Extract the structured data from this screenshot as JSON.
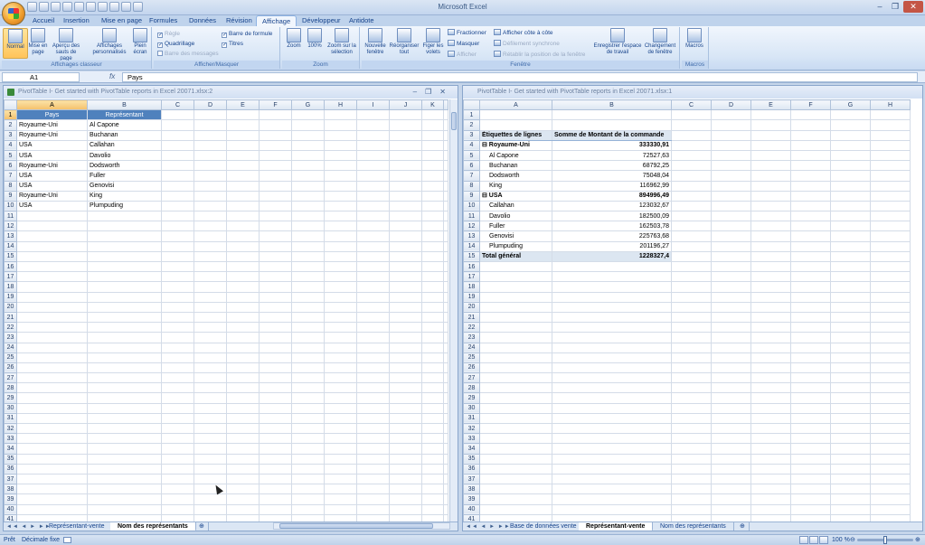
{
  "window": {
    "title": "Microsoft Excel"
  },
  "ribbon_tabs": [
    "Accueil",
    "Insertion",
    "Mise en page",
    "Formules",
    "Données",
    "Révision",
    "Affichage",
    "Développeur",
    "Antidote"
  ],
  "ribbon": {
    "groups": {
      "affichages": "Affichages classeur",
      "afficher": "Afficher/Masquer",
      "zoom": "Zoom",
      "fenetre": "Fenêtre",
      "macros": "Macros"
    },
    "buttons": {
      "normal": "Normal",
      "mise_en_page": "Mise en page",
      "apercu": "Aperçu des sauts de page",
      "affichages_perso": "Affichages personnalisés",
      "plein_ecran": "Plein écran",
      "zoom": "Zoom",
      "cent": "100%",
      "zoom_selection": "Zoom sur la sélection",
      "nouvelle_fenetre": "Nouvelle fenêtre",
      "reorganiser": "Réorganiser tout",
      "figer": "Figer les volets",
      "enregistrer": "Enregistrer l'espace de travail",
      "changement": "Changement de fenêtre",
      "macros": "Macros"
    },
    "checks": {
      "regle": "Règle",
      "quadrillage": "Quadrillage",
      "barre_messages": "Barre des messages",
      "barre_formule": "Barre de formule",
      "titres": "Titres"
    },
    "small": {
      "fractionner": "Fractionner",
      "masquer": "Masquer",
      "afficher": "Afficher",
      "cote": "Afficher côte à côte",
      "defilement": "Défilement synchrone",
      "retablir": "Rétablir la position de la fenêtre"
    }
  },
  "formula_bar": {
    "cell": "A1",
    "fx": "fx",
    "value": "Pays"
  },
  "left_pane": {
    "title": "PivotTable I- Get started with PivotTable reports in Excel 20071.xlsx:2",
    "columns": [
      "A",
      "B",
      "C",
      "D",
      "E",
      "F",
      "G",
      "H",
      "I",
      "J",
      "K"
    ],
    "header": [
      "Pays",
      "Représentant"
    ],
    "rows": [
      [
        "Royaume-Uni",
        "Al Capone"
      ],
      [
        "Royaume-Uni",
        "Buchanan"
      ],
      [
        "USA",
        "Callahan"
      ],
      [
        "USA",
        "Davolio"
      ],
      [
        "Royaume-Uni",
        "Dodsworth"
      ],
      [
        "USA",
        "Fuller"
      ],
      [
        "USA",
        "Genovisi"
      ],
      [
        "Royaume-Uni",
        "King"
      ],
      [
        "USA",
        "Plumpuding"
      ]
    ],
    "tabs": [
      "Représentant-vente",
      "Nom des représentants"
    ]
  },
  "right_pane": {
    "title": "PivotTable I- Get started with PivotTable reports in Excel 20071.xlsx:1",
    "columns": [
      "A",
      "B",
      "C",
      "D",
      "E",
      "F",
      "G",
      "H"
    ],
    "pivot_header": [
      "Étiquettes de lignes",
      "Somme de Montant de la commande"
    ],
    "pivot": [
      {
        "label": "Royaume-Uni",
        "value": "333330,91",
        "type": "group"
      },
      {
        "label": "Al Capone",
        "value": "72527,63",
        "type": "item"
      },
      {
        "label": "Buchanan",
        "value": "68792,25",
        "type": "item"
      },
      {
        "label": "Dodsworth",
        "value": "75048,04",
        "type": "item"
      },
      {
        "label": "King",
        "value": "116962,99",
        "type": "item"
      },
      {
        "label": "USA",
        "value": "894996,49",
        "type": "group"
      },
      {
        "label": "Callahan",
        "value": "123032,67",
        "type": "item"
      },
      {
        "label": "Davolio",
        "value": "182500,09",
        "type": "item"
      },
      {
        "label": "Fuller",
        "value": "162503,78",
        "type": "item"
      },
      {
        "label": "Genovisi",
        "value": "225763,68",
        "type": "item"
      },
      {
        "label": "Plumpuding",
        "value": "201196,27",
        "type": "item"
      },
      {
        "label": "Total général",
        "value": "1228327,4",
        "type": "total"
      }
    ],
    "tabs": [
      "Base de données vente",
      "Représentant-vente",
      "Nom des représentants"
    ]
  },
  "status": {
    "ready": "Prêt",
    "decimal": "Décimale fixe",
    "zoom": "100 %"
  }
}
